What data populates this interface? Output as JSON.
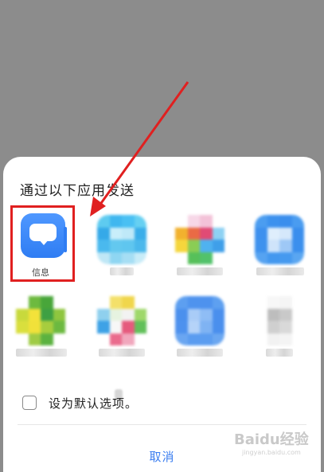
{
  "share_sheet": {
    "title": "通过以下应用发送",
    "apps": [
      {
        "label": "信息",
        "icon": "message-icon",
        "color": "#2f7df3"
      }
    ],
    "default_option_label": "设为默认选项。",
    "cancel_label": "取消"
  },
  "watermark": {
    "main": "Baidu经验",
    "sub": "jingyan.baidu.com"
  },
  "colors": {
    "backdrop": "#8c8c8c",
    "highlight_box": "#e02020",
    "cancel_text": "#3b7ef0"
  }
}
